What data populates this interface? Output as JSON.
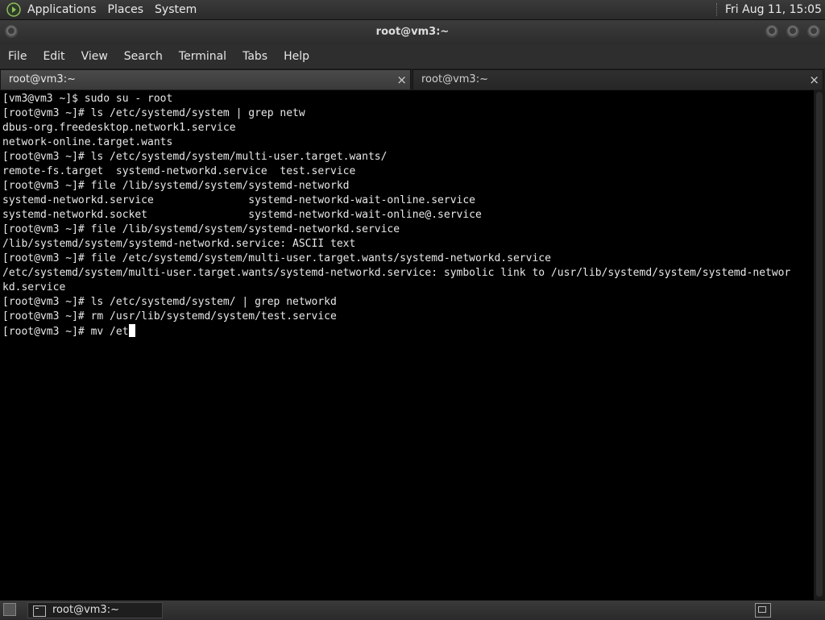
{
  "top_panel": {
    "menus": [
      "Applications",
      "Places",
      "System"
    ],
    "clock": "Fri Aug 11, 15:05"
  },
  "window": {
    "title": "root@vm3:~",
    "menu": [
      "File",
      "Edit",
      "View",
      "Search",
      "Terminal",
      "Tabs",
      "Help"
    ],
    "tabs": [
      {
        "label": "root@vm3:~",
        "close": "×"
      },
      {
        "label": "root@vm3:~",
        "close": "×"
      }
    ]
  },
  "terminal": {
    "lines": [
      "[vm3@vm3 ~]$ sudo su - root",
      "[root@vm3 ~]# ls /etc/systemd/system | grep netw",
      "dbus-org.freedesktop.network1.service",
      "network-online.target.wants",
      "[root@vm3 ~]# ls /etc/systemd/system/multi-user.target.wants/",
      "remote-fs.target  systemd-networkd.service  test.service",
      "[root@vm3 ~]# file /lib/systemd/system/systemd-networkd",
      "systemd-networkd.service               systemd-networkd-wait-online.service",
      "systemd-networkd.socket                systemd-networkd-wait-online@.service",
      "[root@vm3 ~]# file /lib/systemd/system/systemd-networkd.service",
      "/lib/systemd/system/systemd-networkd.service: ASCII text",
      "[root@vm3 ~]# file /etc/systemd/system/multi-user.target.wants/systemd-networkd.service",
      "/etc/systemd/system/multi-user.target.wants/systemd-networkd.service: symbolic link to /usr/lib/systemd/system/systemd-networ",
      "kd.service",
      "[root@vm3 ~]# ls /etc/systemd/system/ | grep networkd",
      "[root@vm3 ~]# rm /usr/lib/systemd/system/test.service"
    ],
    "current_input": "[root@vm3 ~]# mv /et"
  },
  "taskbar": {
    "task_label": "root@vm3:~"
  }
}
